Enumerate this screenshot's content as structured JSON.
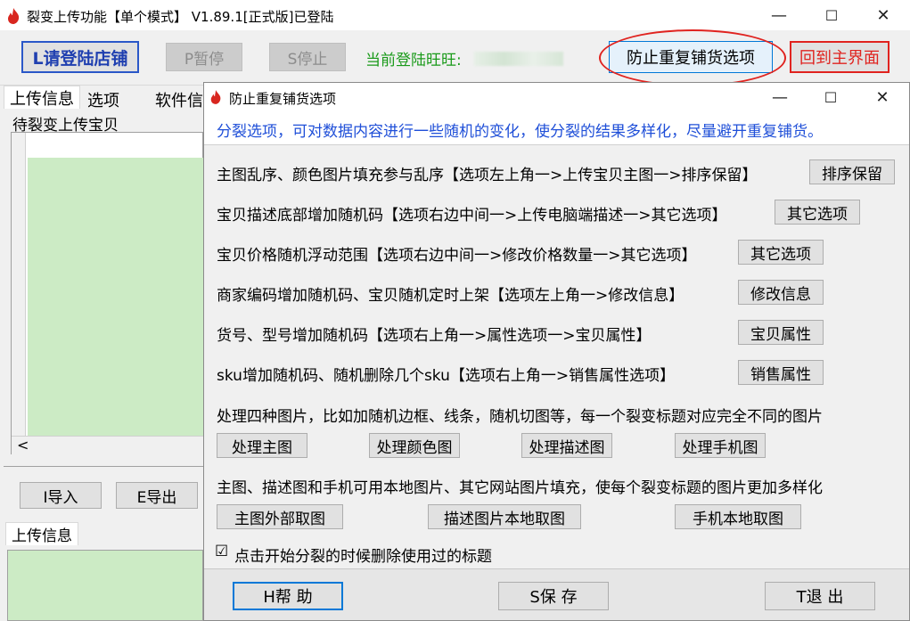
{
  "app": {
    "title": "裂变上传功能【单个模式】 V1.89.1[正式版]已登陆",
    "controls": {
      "minimize": "—",
      "maximize": "☐",
      "close": "✕"
    }
  },
  "toolbar": {
    "login_label": "L请登陆店铺",
    "pause_label": "P暂停",
    "stop_label": "S停止",
    "current_login_label": "当前登陆旺旺:",
    "prevent_dup_label": "防止重复铺货选项",
    "back_label": "回到主界面"
  },
  "main_tabs": [
    "上传信息",
    "选项",
    "软件信"
  ],
  "left_panel": {
    "pending_label": "待裂变上传宝贝",
    "import_label": "I导入",
    "export_label": "E导出",
    "upload_info_tab": "上传信息",
    "scroll_left": "<"
  },
  "dialog": {
    "title": "防止重复铺货选项",
    "controls": {
      "minimize": "—",
      "maximize": "☐",
      "close": "✕"
    },
    "header": "分裂选项，可对数据内容进行一些随机的变化，使分裂的结果多样化，尽量避开重复铺货。",
    "rows": [
      {
        "text": "主图乱序、颜色图片填充参与乱序【选项左上角一>上传宝贝主图一>排序保留】",
        "button": "排序保留"
      },
      {
        "text": "宝贝描述底部增加随机码【选项右边中间一>上传电脑端描述一>其它选项】",
        "button": "其它选项"
      },
      {
        "text": "宝贝价格随机浮动范围【选项右边中间一>修改价格数量一>其它选项】",
        "button": "其它选项"
      },
      {
        "text": "商家编码增加随机码、宝贝随机定时上架【选项左上角一>修改信息】",
        "button": "修改信息"
      },
      {
        "text": "货号、型号增加随机码【选项右上角一>属性选项一>宝贝属性】",
        "button": "宝贝属性"
      },
      {
        "text": "sku增加随机码、随机删除几个sku【选项右上角一>销售属性选项】",
        "button": "销售属性"
      }
    ],
    "image_text": "处理四种图片，比如加随机边框、线条，随机切图等，每一个裂变标题对应完全不同的图片",
    "image_buttons": [
      "处理主图",
      "处理颜色图",
      "处理描述图",
      "处理手机图"
    ],
    "source_text": "主图、描述图和手机可用本地图片、其它网站图片填充，使每个裂变标题的图片更加多样化",
    "source_buttons": [
      "主图外部取图",
      "描述图片本地取图",
      "手机本地取图"
    ],
    "checkbox_label": "点击开始分裂的时候删除使用过的标题",
    "checkbox_mark": "☑",
    "footer": {
      "help": "H帮  助",
      "save": "S保  存",
      "exit": "T退  出"
    }
  },
  "colors": {
    "header_blue": "#1f4fd8",
    "green_text": "#1a9a1a",
    "red": "#e0231f",
    "grid_green": "#ccebc5"
  }
}
